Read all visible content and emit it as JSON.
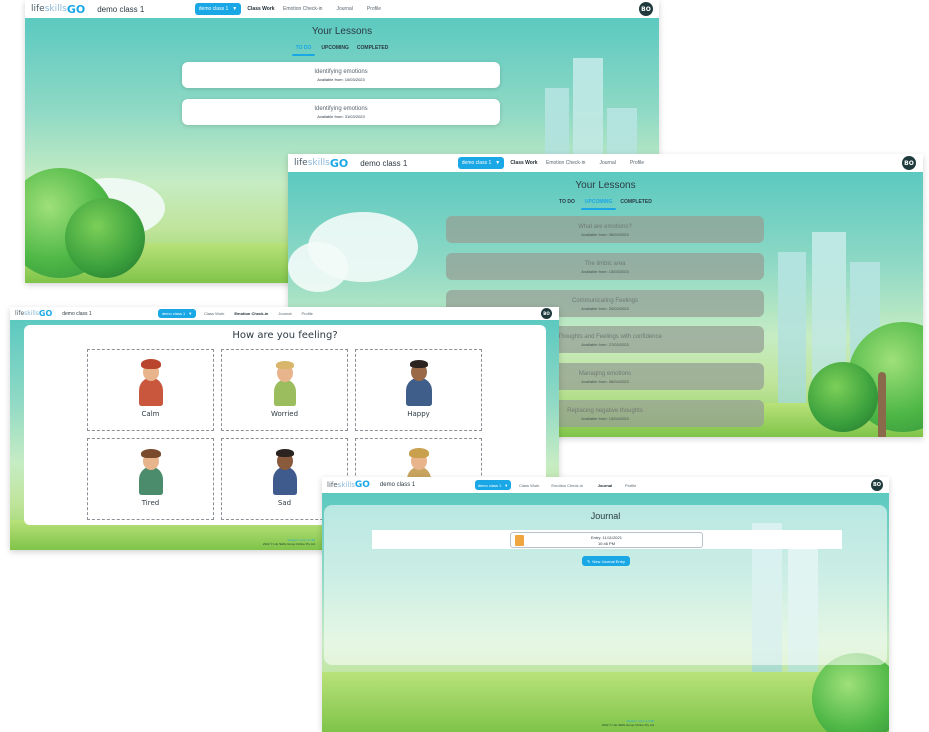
{
  "brand": {
    "life": "life",
    "skills": "skills",
    "go": "GO"
  },
  "class_name": "demo class 1",
  "class_dropdown": "demo class 1",
  "nav": {
    "class_work": "Class Work",
    "emotion_checkin": "Emotion Check-in",
    "journal": "Journal",
    "profile": "Profile"
  },
  "avatar_initials": "BO",
  "lessons_title": "Your Lessons",
  "tabs": {
    "todo": "TO DO",
    "upcoming": "UPCOMING",
    "completed": "COMPLETED"
  },
  "todo_lessons": [
    {
      "name": "Identifying emotions",
      "available": "Available from: 10/03/2023"
    },
    {
      "name": "Identifying emotions",
      "available": "Available from: 31/03/2023"
    }
  ],
  "upcoming_lessons": [
    {
      "name": "What are emotions?",
      "available": "Available from: 06/03/2023"
    },
    {
      "name": "The limbic area",
      "available": "Available from: 13/03/2023"
    },
    {
      "name": "Communicating Feelings",
      "available": "Available from: 20/03/2023"
    },
    {
      "name": "ing Thoughts and Feelings with confidence",
      "available": "Available from: 27/03/2023"
    },
    {
      "name": "Managing emotions",
      "available": "Available from: 06/04/2023"
    },
    {
      "name": "Replacing negative thoughts",
      "available": "Available from: 13/04/2023"
    }
  ],
  "emotion": {
    "title": "How are you feeling?",
    "options": [
      "Calm",
      "Worried",
      "Happy",
      "Tired",
      "Sad",
      ""
    ]
  },
  "journal": {
    "title": "Journal",
    "entry_date": "Entry: 11/11/2021",
    "entry_time": "10:46 PM",
    "new_entry": "New Journal Entry"
  },
  "footer": {
    "version": "Version: 1.0.1.1.2.25",
    "copyright": "2022 © Life Skills Group Online Pty Ltd"
  },
  "colors": {
    "accent": "#1aa7e6",
    "avatar": "#1f3a3d",
    "text": "#2c3a44"
  },
  "icons": {
    "dropdown": "chevron-down-icon",
    "journal_file": "document-icon",
    "pencil": "pencil-icon"
  }
}
